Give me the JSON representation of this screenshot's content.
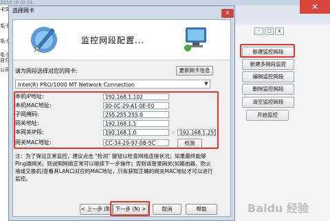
{
  "background": {
    "top_text": "2010 (0 (0 01:",
    "left_fragments": [
      "卡文",
      "毛-聚",
      "毛-保",
      "毛-详",
      "自介",
      "公司"
    ]
  },
  "right_panel": {
    "controls": [
      "-",
      "□",
      "x"
    ],
    "buttons": [
      "新建监控网段",
      "新建多网段监控",
      "编辑监控网段",
      "删除监控网段",
      "清空监控网段",
      "开始监控"
    ]
  },
  "dialog": {
    "title": "选择网卡",
    "close": "x",
    "heading": "监控网段配置...",
    "prompt": "请为网段选择对应的网卡:",
    "refresh_button": "更新网卡信息",
    "adapter": "Intel(R) PRO/1000 MT Network Connection",
    "fields": {
      "ip_label": "本机IP地址:",
      "ip": "192.168.1.102",
      "mac_label": "本机MAC地址:",
      "mac": "00-0C-29-A1-0E-E0",
      "mask_label": "子网掩码:",
      "mask": "255.255.255.0",
      "gateway_label": "网关地址:",
      "gateway": "192.168.1.1",
      "range_label": "本网关IP段:",
      "range_start": "192.168.1.0",
      "range_dash": "-",
      "range_end": "192.168.1.255",
      "gwmac_label": "网关MAC地址:",
      "gwmac": "CC-34-29-97-0B-5C",
      "detect_button": "检测"
    },
    "note": "注：为了保证正常监控，建议点击 \"检测\" 按钮以检查网络连接状况；如果最终能够Ping通网关，则说明网络正常可以继续下一步操作；否则请登录网关(如路由器、防火墙或交换机)查看其LAN口对应的MAC地址，只有获取正确的网关MAC地址才可以进行监控。",
    "buttons": {
      "back": "< 上一步 (B)",
      "next": "下一步 (N) >",
      "cancel": "取消",
      "help": "帮助"
    }
  },
  "watermark": "Baidu 经验",
  "colors": {
    "highlight": "#e8352b",
    "dialog_frame": "#cfdbea"
  }
}
